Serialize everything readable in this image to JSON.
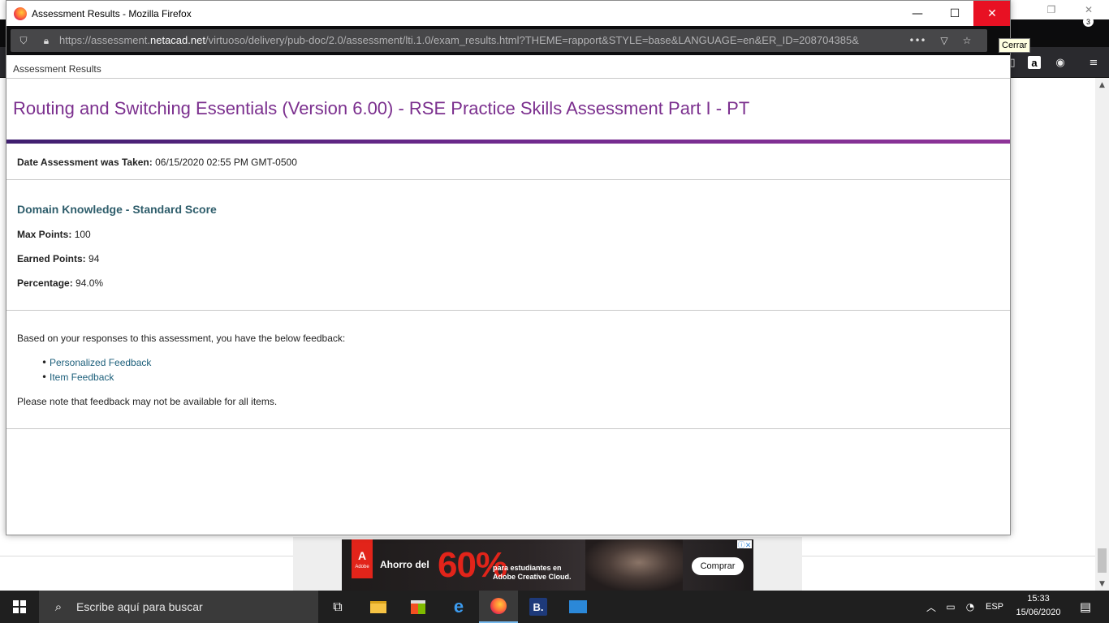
{
  "window": {
    "title": "Assessment Results - Mozilla Firefox",
    "minimize_glyph": "—",
    "maximize_glyph": "☐",
    "close_glyph": "✕",
    "close_tooltip": "Cerrar"
  },
  "urlbar": {
    "prefix": "https://assessment.",
    "domain": "netacad.net",
    "path": "/virtuoso/delivery/pub-doc/2.0/assessment/lti.1.0/exam_results.html?THEME=rapport&STYLE=base&LANGUAGE=en&ER_ID=208704385&",
    "more_glyph": "•••",
    "menu_glyph": "≡"
  },
  "page": {
    "header_title": "Assessment Results",
    "assessment_title": "Routing and Switching Essentials (Version 6.00) - RSE Practice Skills Assessment Part I - PT",
    "date_label": "Date Assessment was Taken:",
    "date_value": "06/15/2020 02:55 PM GMT-0500",
    "score_heading": "Domain Knowledge - Standard Score",
    "max_points_label": "Max Points:",
    "max_points_value": "100",
    "earned_points_label": "Earned Points:",
    "earned_points_value": "94",
    "percentage_label": "Percentage:",
    "percentage_value": "94.0%",
    "feedback_intro": "Based on your responses to this assessment, you have the below feedback:",
    "feedback_links": [
      "Personalized Feedback",
      "Item Feedback"
    ],
    "feedback_note": "Please note that feedback may not be available for all items."
  },
  "ad": {
    "logo_letter": "A",
    "logo_caption": "Adobe",
    "save_text": "Ahorro del",
    "percent": "60%",
    "subtext": "para estudiantes en Adobe Creative Cloud.",
    "cta": "Comprar"
  },
  "taskbar": {
    "search_placeholder": "Escribe aquí para buscar",
    "booking_letter": "B.",
    "language": "ESP",
    "time": "15:33",
    "date": "15/06/2020",
    "notification_count": "3"
  },
  "colors": {
    "title_purple": "#7b2f8e",
    "heading_teal": "#2e5d6b",
    "link_blue": "#1b5e7a",
    "close_red": "#e81123"
  }
}
